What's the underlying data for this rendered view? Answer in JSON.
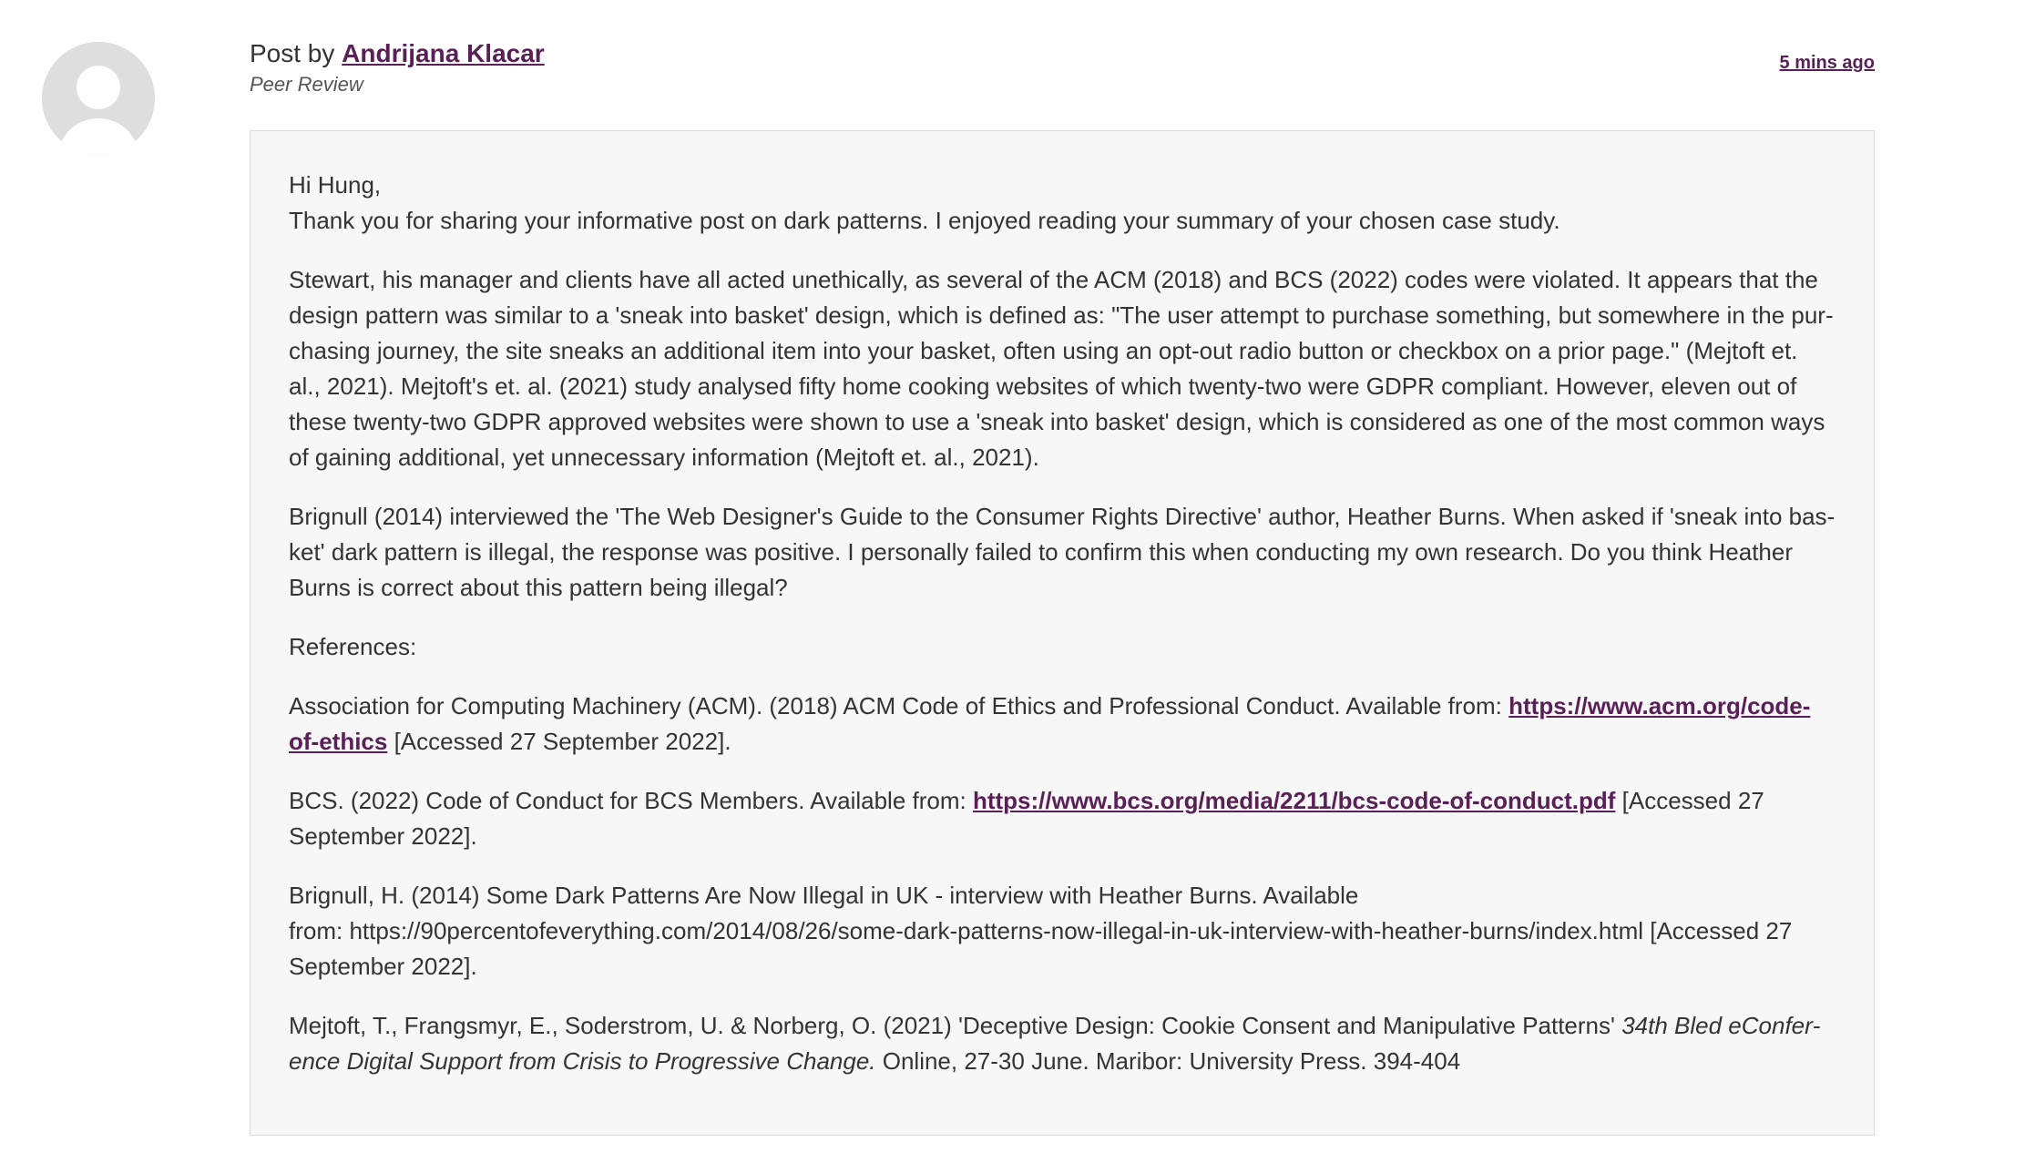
{
  "post": {
    "by_prefix": "Post by ",
    "author": "Andrijana Klacar",
    "role": "Peer Review",
    "time": "5 mins ago"
  },
  "body": {
    "greeting": "Hi Hung,",
    "intro": "Thank you for sharing your informative post on dark patterns. I enjoyed reading your summary of your chosen case study.",
    "para1": "Stewart, his manager and clients have all acted unethically, as several of the ACM (2018) and BCS (2022) codes were violated. It appears that the design pattern was similar to a 'sneak into basket' design, which is defined as: \"The user attempt to purchase something, but somewhere in the pur­chasing journey, the site sneaks an additional item into your basket, often using an opt-out radio button or checkbox on a prior page.\" (Mejtoft et. al., 2021). Mejtoft's et. al. (2021) study analysed fifty home cooking websites of which twenty-two were GDPR compliant. However, eleven out of these twenty-two GDPR approved websites were shown to use a 'sneak into basket' design, which is considered as one of the most common ways of gaining additional, yet unnecessary information (Mejtoft et. al., 2021).",
    "para2": "Brignull (2014) interviewed the 'The Web Designer's Guide to the Consumer Rights Directive' author, Heather Burns. When asked if 'sneak into bas­ket' dark pattern is illegal, the response was positive. I personally failed to confirm this when conducting my own research. Do you think Heather Burns is correct about this pattern being illegal?",
    "references_heading": "References:",
    "ref1_text": "Association for Computing Machinery (ACM). (2018) ACM Code of Ethics and Professional Conduct. Available from: ",
    "ref1_link": "https://www.acm.org/code-of-ethics",
    "ref1_after": " [Accessed 27 September 2022].",
    "ref2_text": "BCS. (2022) Code of Conduct for BCS Members. Available from: ",
    "ref2_link": "https://www.bcs.org/media/2211/bcs-code-of-conduct.pdf",
    "ref2_after": " [Accessed 27 September 2022].",
    "ref3_line1": "Brignull, H. (2014) Some Dark Patterns Are Now Illegal in UK - interview with Heather Burns. Available",
    "ref3_line2": "from: https://90percentofeverything.com/2014/08/26/some-dark-patterns-now-illegal-in-uk-interview-with-heather-burns/index.html [Accessed 27 September 2022].",
    "ref4_text": "Mejtoft, T., Frangsmyr, E., Soderstrom, U. & Norberg, O. (2021) 'Deceptive Design: Cookie Consent and Manipulative Patterns' ",
    "ref4_italic": "34th Bled eConfer­ence Digital Support from Crisis to Progressive Change.",
    "ref4_after": " Online, 27-30 June. Maribor: University Press. 394-404"
  },
  "colors": {
    "link": "#5b1f57",
    "text": "#333333",
    "box_bg": "#f7f7f7",
    "box_border": "#dcdcdc",
    "avatar": "#dedede"
  },
  "icons": {
    "avatar": "user-silhouette-icon"
  }
}
